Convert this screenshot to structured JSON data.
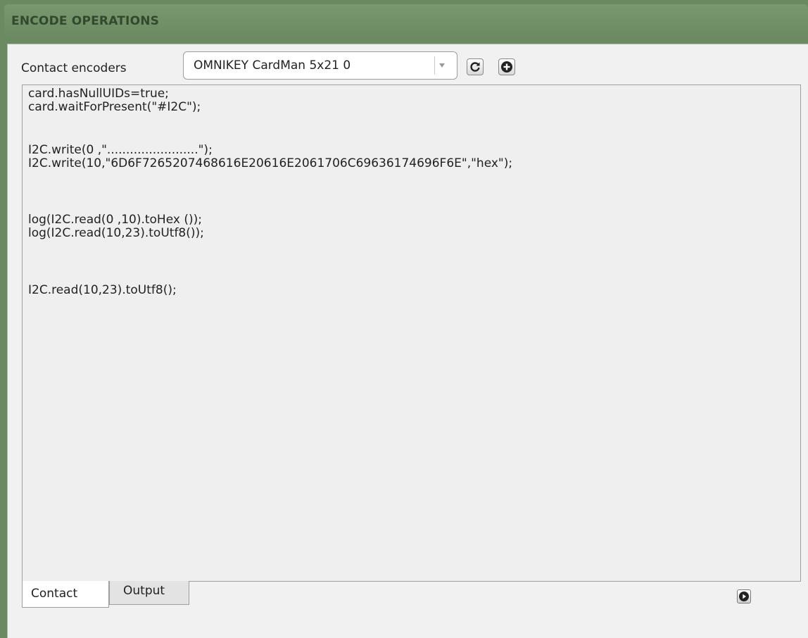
{
  "window": {
    "title": "ENCODE OPERATIONS"
  },
  "encoder": {
    "label": "Contact encoders",
    "selected": "OMNIKEY CardMan 5x21 0",
    "refresh_icon": "refresh-icon",
    "add_icon": "plus-circle-icon"
  },
  "editor": {
    "lines": [
      "card.hasNullUIDs=true;",
      "card.waitForPresent(\"#I2C\");",
      "",
      "I2C.write(0 ,\"........................\");",
      "I2C.write(10,\"6D6F7265207468616E20616E2061706C69636174696F6E\",\"hex\");",
      "",
      "",
      "log(I2C.read(0 ,10).toHex ());",
      "log(I2C.read(10,23).toUtf8());",
      "",
      "",
      "I2C.read(10,23).toUtf8();"
    ]
  },
  "tabs": [
    {
      "label": "Contact",
      "active": true
    },
    {
      "label": "Output",
      "active": false
    }
  ],
  "run_icon": "play-circle-icon",
  "colors": {
    "titlebar": "#6b8a62",
    "title_text": "#2f4a2c",
    "panel_bg": "#f1f1f1"
  }
}
